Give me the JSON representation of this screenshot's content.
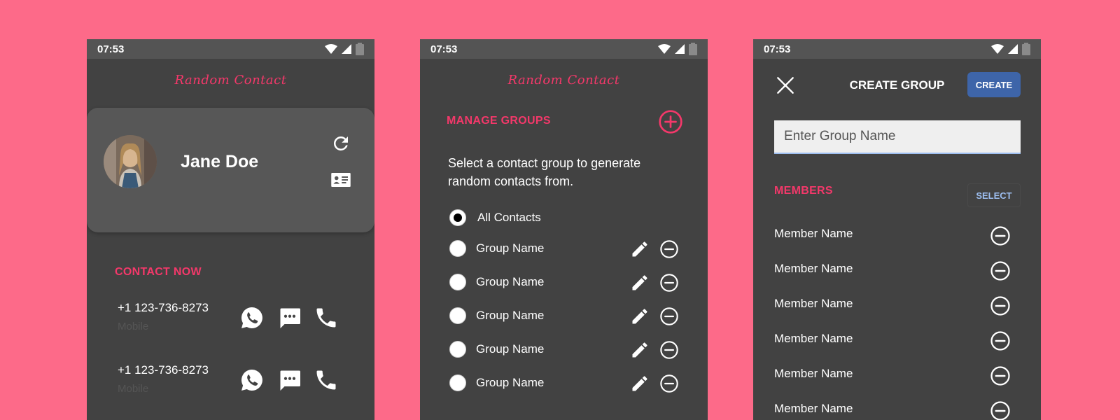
{
  "colors": {
    "background": "#fd6a89",
    "panel": "#424242",
    "accent": "#f4386a",
    "primary": "#3e65a9"
  },
  "screens": [
    {
      "time": "07:53",
      "app_title": "Random Contact",
      "profile": {
        "name": "Jane Doe"
      },
      "section_title": "CONTACT NOW",
      "contacts": [
        {
          "number": "+1 123-736-8273",
          "type": "Mobile"
        },
        {
          "number": "+1 123-736-8273",
          "type": "Mobile"
        }
      ]
    },
    {
      "time": "07:53",
      "app_title": "Random Contact",
      "section_title": "MANAGE GROUPS",
      "description": "Select a contact group to generate random contacts from.",
      "groups": [
        {
          "label": "All Contacts",
          "selected": true
        },
        {
          "label": "Group Name",
          "selected": false
        },
        {
          "label": "Group Name",
          "selected": false
        },
        {
          "label": "Group Name",
          "selected": false
        },
        {
          "label": "Group Name",
          "selected": false
        },
        {
          "label": "Group Name",
          "selected": false
        }
      ]
    },
    {
      "time": "07:53",
      "title": "CREATE GROUP",
      "create_label": "CREATE",
      "input_placeholder": "Enter Group Name",
      "members_title": "MEMBERS",
      "select_label": "SELECT",
      "members": [
        "Member Name",
        "Member Name",
        "Member Name",
        "Member Name",
        "Member Name",
        "Member Name"
      ]
    }
  ],
  "icons": [
    "wifi-icon",
    "signal-icon",
    "battery-icon",
    "refresh-icon",
    "contact-card-icon",
    "add-circle-icon",
    "whatsapp-icon",
    "message-icon",
    "phone-icon",
    "edit-icon",
    "remove-circle-icon",
    "close-icon"
  ]
}
